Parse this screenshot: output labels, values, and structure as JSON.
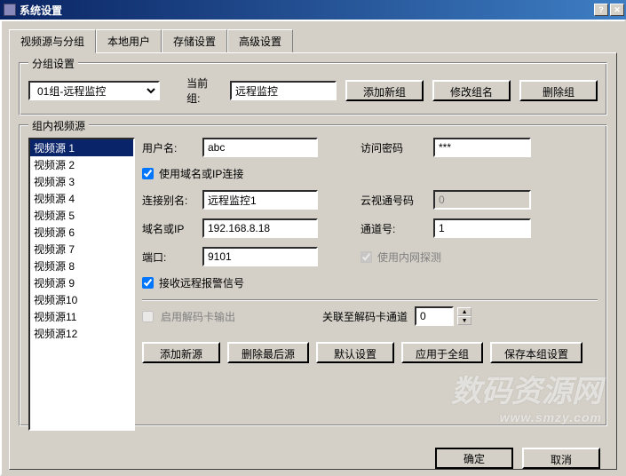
{
  "window": {
    "title": "系统设置"
  },
  "tabs": [
    "视频源与分组",
    "本地用户",
    "存储设置",
    "高级设置"
  ],
  "group_settings": {
    "title": "分组设置",
    "dropdown_value": "01组-远程监控",
    "current_group_label": "当前组:",
    "current_group_value": "远程监控",
    "add_group_btn": "添加新组",
    "rename_group_btn": "修改组名",
    "delete_group_btn": "删除组"
  },
  "source_group": {
    "title": "组内视频源",
    "items": [
      "视频源 1",
      "视频源 2",
      "视频源 3",
      "视频源 4",
      "视频源 5",
      "视频源 6",
      "视频源 7",
      "视频源 8",
      "视频源 9",
      "视频源10",
      "视频源11",
      "视频源12"
    ]
  },
  "form": {
    "username_label": "用户名:",
    "username_value": "abc",
    "password_label": "访问密码",
    "password_value": "***",
    "use_domain_checkbox": "使用域名或IP连接",
    "alias_label": "连接别名:",
    "alias_value": "远程监控1",
    "cloud_label": "云视通号码",
    "cloud_value": "0",
    "domain_label": "域名或IP",
    "domain_value": "192.168.8.18",
    "channel_label": "通道号:",
    "channel_value": "1",
    "port_label": "端口:",
    "port_value": "9101",
    "intranet_checkbox": "使用内网探测",
    "alarm_checkbox": "接收远程报警信号",
    "decode_out_checkbox": "启用解码卡输出",
    "decode_channel_label": "关联至解码卡通道",
    "decode_channel_value": "0"
  },
  "action_buttons": {
    "add_source": "添加新源",
    "delete_last": "删除最后源",
    "default_settings": "默认设置",
    "apply_all": "应用于全组",
    "save_group": "保存本组设置"
  },
  "dialog_buttons": {
    "ok": "确定",
    "cancel": "取消"
  },
  "watermark": {
    "main": "数码资源网",
    "sub": "www.smzy.com"
  }
}
